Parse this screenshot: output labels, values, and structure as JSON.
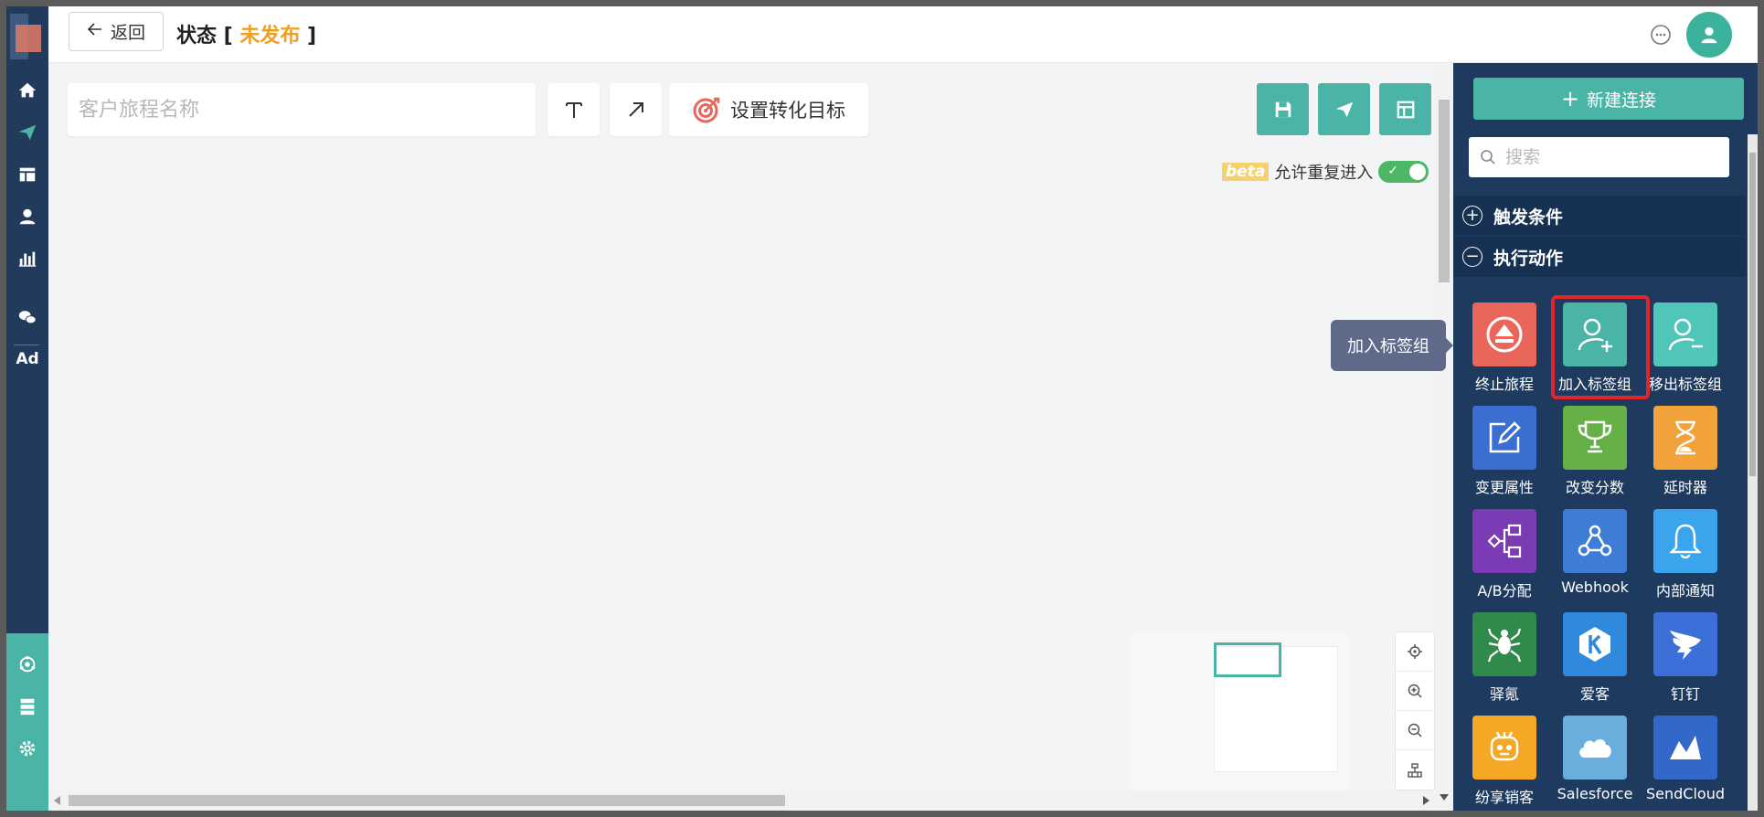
{
  "header": {
    "back_label": "返回",
    "status_prefix": "状态 [ ",
    "status_value": "未发布",
    "status_suffix": " ]"
  },
  "toolbar": {
    "name_placeholder": "客户旅程名称",
    "text_tool": "T",
    "goal_label": "设置转化目标"
  },
  "options": {
    "beta_tag": "beta",
    "allow_reentry_label": "允许重复进入",
    "allow_reentry_on": true
  },
  "panel": {
    "new_connection_label": "新建连接",
    "search_placeholder": "搜索",
    "sections": {
      "triggers": {
        "label": "触发条件",
        "expanded": false
      },
      "actions": {
        "label": "执行动作",
        "expanded": true
      }
    },
    "tiles": [
      {
        "label": "终止旅程",
        "color": "#e8675a",
        "icon": "eject-icon"
      },
      {
        "label": "加入标签组",
        "color": "#4ab4a6",
        "icon": "user-add-icon",
        "highlighted": true
      },
      {
        "label": "移出标签组",
        "color": "#4fc6b8",
        "icon": "user-remove-icon"
      },
      {
        "label": "变更属性",
        "color": "#3a6fd1",
        "icon": "edit-icon"
      },
      {
        "label": "改变分数",
        "color": "#66b047",
        "icon": "trophy-icon"
      },
      {
        "label": "延时器",
        "color": "#f2a23a",
        "icon": "hourglass-icon"
      },
      {
        "label": "A/B分配",
        "color": "#7a3bb5",
        "icon": "ab-split-icon"
      },
      {
        "label": "Webhook",
        "color": "#3d7dd6",
        "icon": "webhook-icon"
      },
      {
        "label": "内部通知",
        "color": "#3aa4ec",
        "icon": "bell-icon"
      },
      {
        "label": "驿氪",
        "color": "#2f8a4b",
        "icon": "spider-icon"
      },
      {
        "label": "爱客",
        "color": "#2f89dd",
        "icon": "k-icon"
      },
      {
        "label": "钉钉",
        "color": "#3c6fd8",
        "icon": "dingtalk-icon"
      },
      {
        "label": "纷享销客",
        "color": "#f4a826",
        "icon": "robot-icon"
      },
      {
        "label": "Salesforce",
        "color": "#6aaede",
        "icon": "cloud-icon"
      },
      {
        "label": "SendCloud",
        "color": "#3269c9",
        "icon": "sendcloud-icon"
      }
    ],
    "tooltip": "加入标签组"
  },
  "colors": {
    "accent": "#4ab4a6",
    "nav_bg": "#223a5c",
    "status_value": "#f0a020",
    "highlight": "#e0262c"
  }
}
